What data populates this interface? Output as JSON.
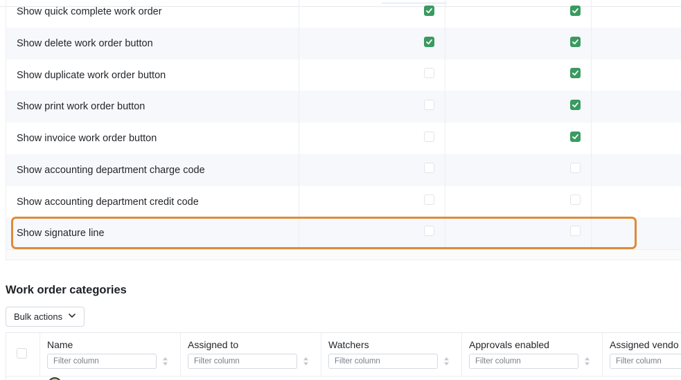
{
  "settings": {
    "rows": [
      {
        "label": "Show quick complete work order",
        "col1": true,
        "col2": true
      },
      {
        "label": "Show delete work order button",
        "col1": true,
        "col2": true
      },
      {
        "label": "Show duplicate work order button",
        "col1": false,
        "col2": true
      },
      {
        "label": "Show print work order button",
        "col1": false,
        "col2": true
      },
      {
        "label": "Show invoice work order button",
        "col1": false,
        "col2": true
      },
      {
        "label": "Show accounting department charge code",
        "col1": false,
        "col2": false
      },
      {
        "label": "Show accounting department credit code",
        "col1": false,
        "col2": false
      },
      {
        "label": "Show signature line",
        "col1": false,
        "col2": false
      }
    ],
    "highlighted_row": "Show signature line",
    "highlight_color": "#e08a36",
    "check_color": "#3a9a60"
  },
  "categories": {
    "title": "Work order categories",
    "bulk_actions_label": "Bulk actions",
    "columns": [
      {
        "header": "Name",
        "filter_placeholder": "Filter column"
      },
      {
        "header": "Assigned to",
        "filter_placeholder": "Filter column"
      },
      {
        "header": "Watchers",
        "filter_placeholder": "Filter column"
      },
      {
        "header": "Approvals enabled",
        "filter_placeholder": "Filter column"
      },
      {
        "header": "Assigned vendo",
        "filter_placeholder": "Filter column"
      }
    ]
  }
}
